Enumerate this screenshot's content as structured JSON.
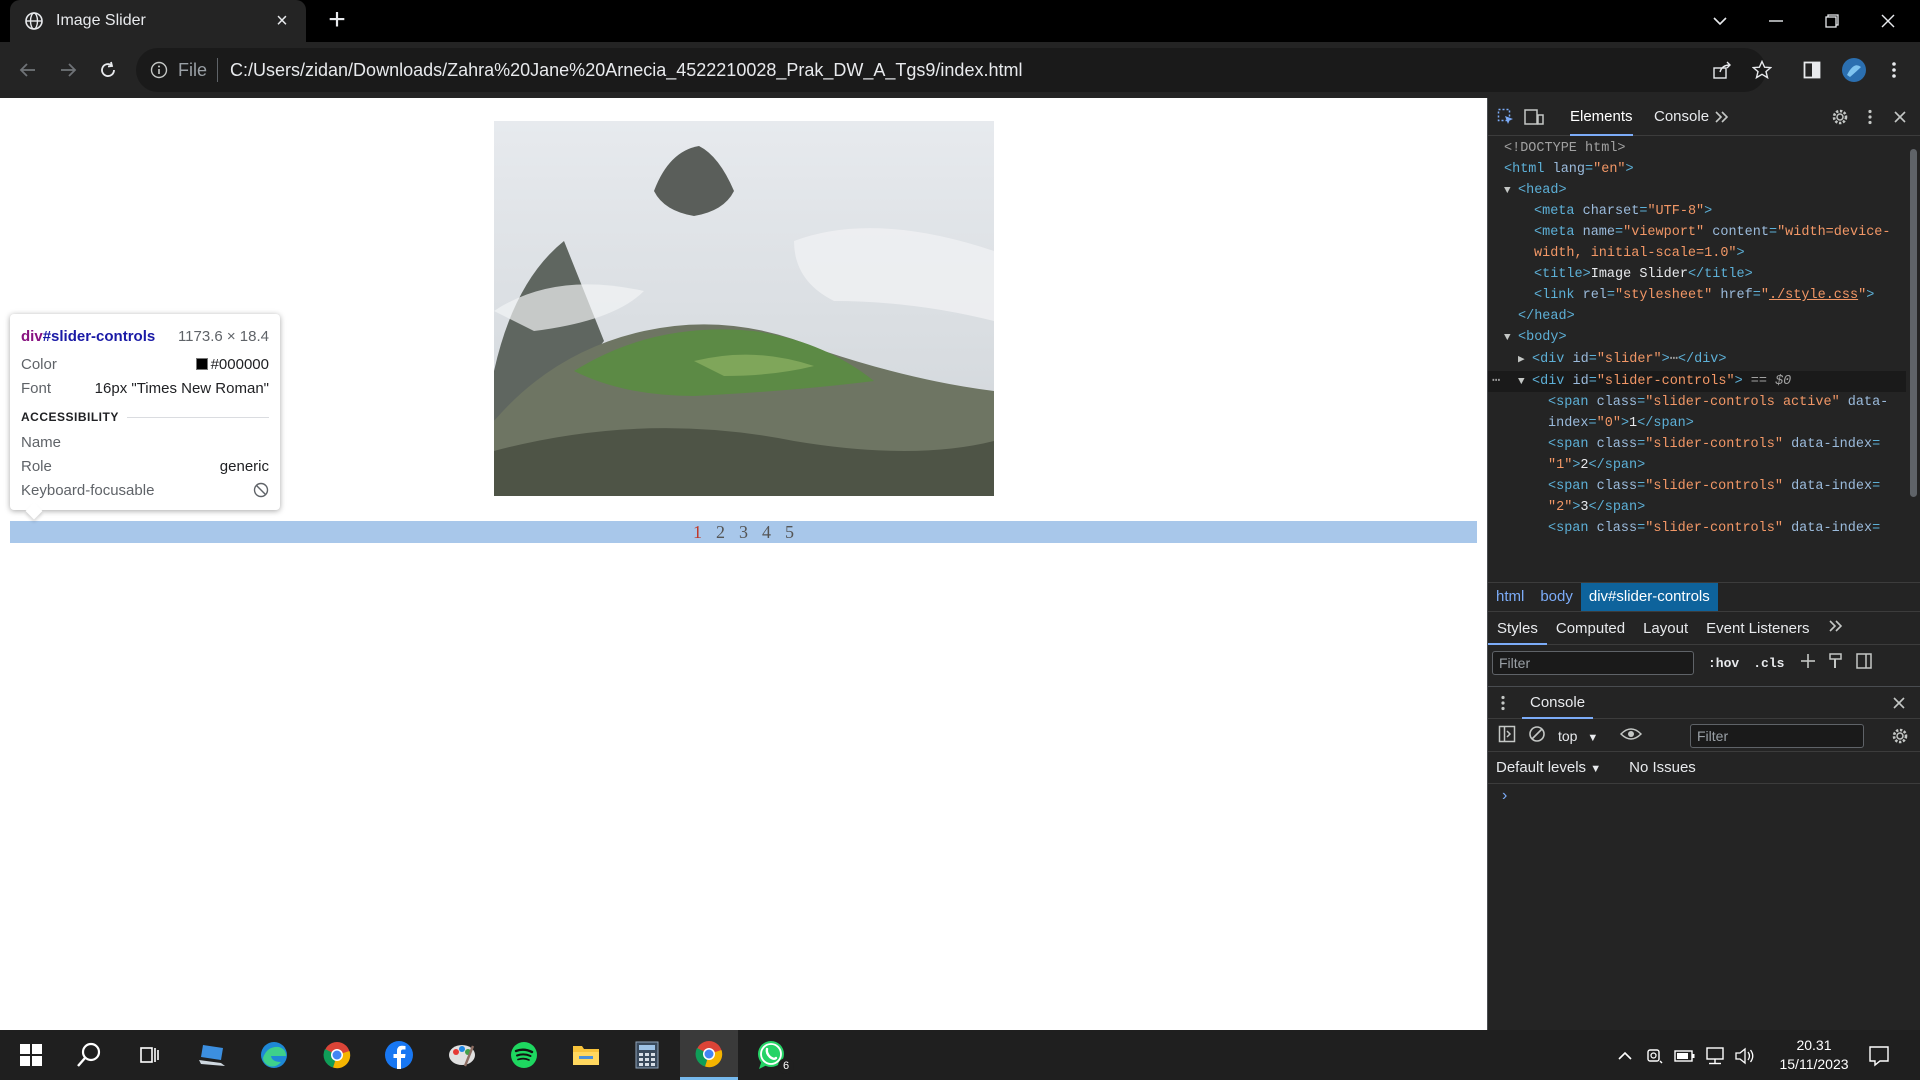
{
  "browser": {
    "tab_title": "Image Slider",
    "omnibox_scheme_label": "File",
    "url": "C:/Users/zidan/Downloads/Zahra%20Jane%20Arnecia_4522210028_Prak_DW_A_Tgs9/index.html"
  },
  "page": {
    "slider_controls": [
      "1",
      "2",
      "3",
      "4",
      "5"
    ],
    "active_index": 0,
    "active_color": "#c0392b",
    "controls_bg": "#a8c7ea"
  },
  "tooltip": {
    "tag": "div",
    "id": "#slider-controls",
    "size": "1173.6 × 18.4",
    "color_label": "Color",
    "color_value": "#000000",
    "font_label": "Font",
    "font_value": "16px \"Times New Roman\"",
    "accessibility_heading": "ACCESSIBILITY",
    "name_label": "Name",
    "role_label": "Role",
    "role_value": "generic",
    "focusable_label": "Keyboard-focusable"
  },
  "devtools": {
    "tabs": {
      "elements": "Elements",
      "console": "Console"
    },
    "dom": {
      "doctype": "<!DOCTYPE html>",
      "selected_marker": "== $0"
    },
    "breadcrumbs": [
      "html",
      "body",
      "div#slider-controls"
    ],
    "sub_tabs": [
      "Styles",
      "Computed",
      "Layout",
      "Event Listeners"
    ],
    "styles_filter_placeholder": "Filter",
    "hov_label": ":hov",
    "cls_label": ".cls",
    "drawer_tab": "Console",
    "context": "top",
    "console_filter_placeholder": "Filter",
    "levels_label": "Default levels",
    "issues_label": "No Issues",
    "prompt": "›"
  },
  "taskbar": {
    "whatsapp_badge": "6",
    "time": "20.31",
    "date": "15/11/2023"
  }
}
